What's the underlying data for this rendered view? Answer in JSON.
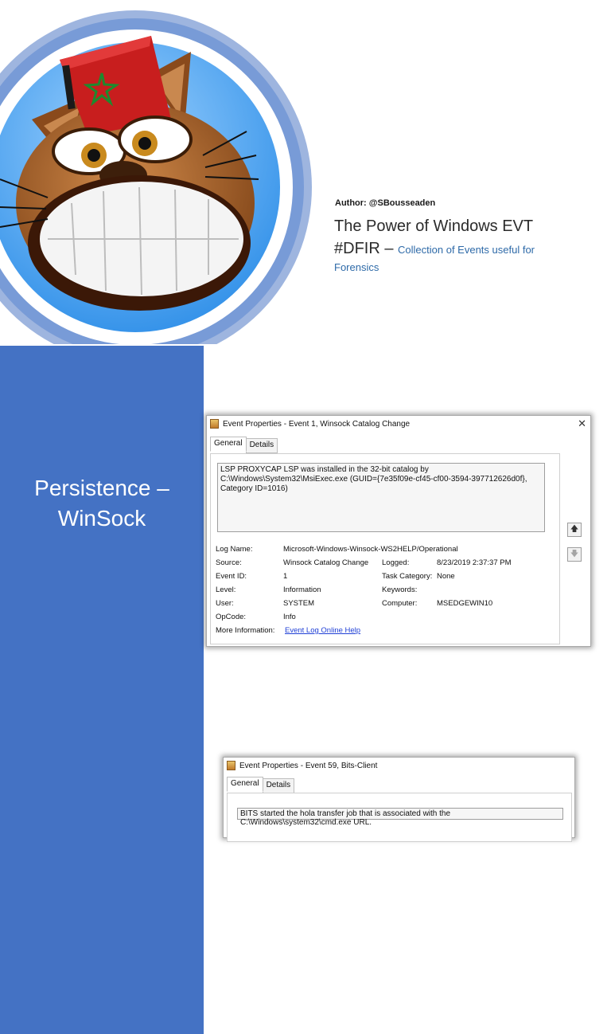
{
  "cover": {
    "author": "Author: @SBousseaden",
    "title_line1": "The Power of Windows EVT",
    "title_line2_prefix": "#DFIR – ",
    "title_line2_rest": "Collection of Events useful for",
    "title_line3": "Forensics"
  },
  "slide1": {
    "section_title_line1": "Persistence –",
    "section_title_line2": "WinSock",
    "window": {
      "title": "Event Properties - Event 1, Winsock Catalog Change",
      "close_glyph": "✕",
      "tabs": [
        "General",
        "Details"
      ],
      "description": "LSP PROXYCAP LSP was installed in the 32-bit catalog by C:\\Windows\\System32\\MsiExec.exe (GUID={7e35f09e-cf45-cf00-3594-397712626d0f}, Category ID=1016)",
      "fields": {
        "log_name_label": "Log Name:",
        "log_name_value": "Microsoft-Windows-Winsock-WS2HELP/Operational",
        "source_label": "Source:",
        "source_value": "Winsock Catalog Change",
        "logged_label": "Logged:",
        "logged_value": "8/23/2019 2:37:37 PM",
        "event_id_label": "Event ID:",
        "event_id_value": "1",
        "task_category_label": "Task Category:",
        "task_category_value": "None",
        "level_label": "Level:",
        "level_value": "Information",
        "keywords_label": "Keywords:",
        "keywords_value": "",
        "user_label": "User:",
        "user_value": "SYSTEM",
        "computer_label": "Computer:",
        "computer_value": "MSEDGEWIN10",
        "opcode_label": "OpCode:",
        "opcode_value": "Info",
        "more_info_label": "More Information:",
        "more_info_link": "Event Log Online Help"
      },
      "arrow_up": "🡅",
      "arrow_down": "🡇"
    }
  },
  "slide2": {
    "window": {
      "title": "Event Properties - Event 59, Bits-Client",
      "tabs": [
        "General",
        "Details"
      ],
      "description": "BITS started the hola transfer job that is associated with the C:\\Windows\\system32\\cmd.exe URL."
    }
  },
  "colors": {
    "section_blue": "#4472c4",
    "subtitle_blue": "#2e6aa8",
    "link_blue": "#1f3fd6"
  },
  "icons": [
    "cat-mascot-fez-logo",
    "event-viewer-app-icon",
    "close-icon",
    "arrow-up-icon",
    "arrow-down-icon"
  ]
}
